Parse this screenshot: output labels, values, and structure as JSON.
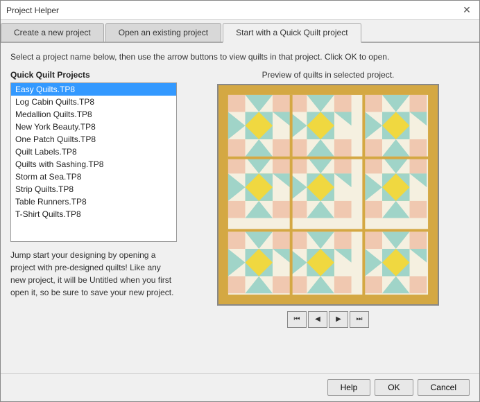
{
  "window": {
    "title": "Project Helper",
    "close_label": "✕"
  },
  "tabs": [
    {
      "id": "new",
      "label": "Create a new project",
      "active": false
    },
    {
      "id": "open",
      "label": "Open an existing project",
      "active": false
    },
    {
      "id": "quick",
      "label": "Start with a Quick Quilt project",
      "active": true
    }
  ],
  "instruction": "Select a project name below, then use the arrow buttons to view quilts in that project. Click OK to open.",
  "left": {
    "list_label": "Quick Quilt Projects",
    "projects": [
      "Easy Quilts.TP8",
      "Log Cabin Quilts.TP8",
      "Medallion Quilts.TP8",
      "New York Beauty.TP8",
      "One Patch Quilts.TP8",
      "Quilt Labels.TP8",
      "Quilts with Sashing.TP8",
      "Storm at Sea.TP8",
      "Strip Quilts.TP8",
      "Table Runners.TP8",
      "T-Shirt Quilts.TP8"
    ],
    "selected_index": 0,
    "description": "Jump start your designing by opening a project with pre-designed quilts! Like any new project, it will be Untitled when you first open it, so be sure to save your new project."
  },
  "preview": {
    "label": "Preview of quilts in selected project."
  },
  "nav_buttons": [
    {
      "id": "first",
      "symbol": "⏮"
    },
    {
      "id": "prev",
      "symbol": "◀"
    },
    {
      "id": "next",
      "symbol": "▶"
    },
    {
      "id": "last",
      "symbol": "⏭"
    }
  ],
  "footer": {
    "help_label": "Help",
    "ok_label": "OK",
    "cancel_label": "Cancel"
  }
}
